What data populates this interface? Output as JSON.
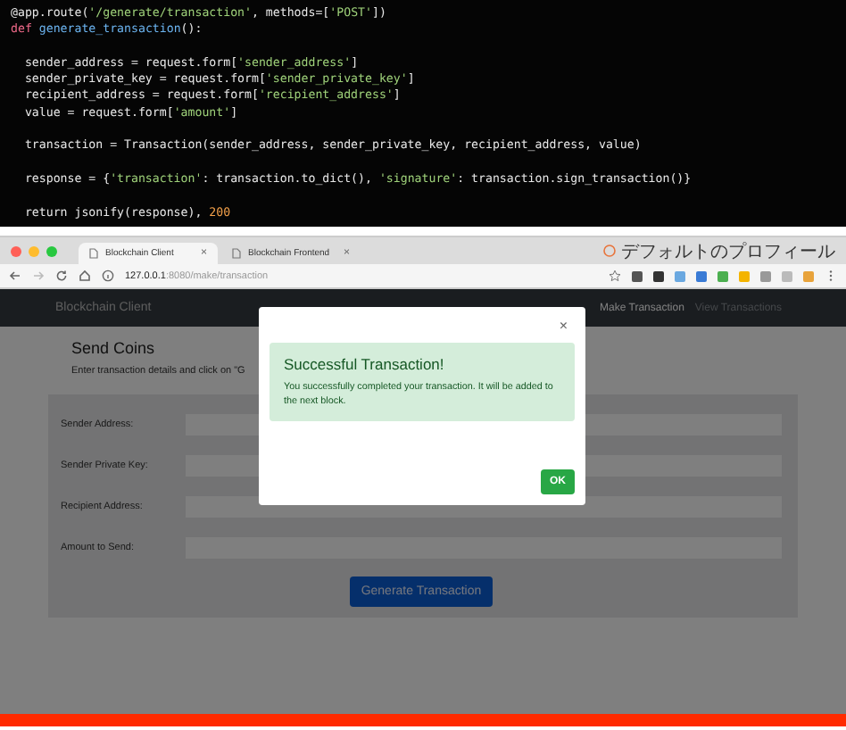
{
  "code": {
    "lines": [
      {
        "blank_before": false,
        "tokens": [
          {
            "text": "@app.route(",
            "kind": "plain"
          },
          {
            "text": "'/generate/transaction'",
            "kind": "string"
          },
          {
            "text": ", methods=[",
            "kind": "plain"
          },
          {
            "text": "'POST'",
            "kind": "string"
          },
          {
            "text": "])",
            "kind": "plain"
          }
        ]
      },
      {
        "blank_before": false,
        "tokens": [
          {
            "text": "def",
            "kind": "keyword"
          },
          {
            "text": " generate_transaction",
            "kind": "function"
          },
          {
            "text": "():",
            "kind": "plain"
          }
        ]
      },
      {
        "blank_before": true,
        "tokens": [
          {
            "text": "  sender_address = request.form[",
            "kind": "plain"
          },
          {
            "text": "'sender_address'",
            "kind": "string"
          },
          {
            "text": "]",
            "kind": "plain"
          }
        ]
      },
      {
        "blank_before": false,
        "tokens": [
          {
            "text": "  sender_private_key = request.form[",
            "kind": "plain"
          },
          {
            "text": "'sender_private_key'",
            "kind": "string"
          },
          {
            "text": "]",
            "kind": "plain"
          }
        ]
      },
      {
        "blank_before": false,
        "tokens": [
          {
            "text": "  recipient_address = request.form[",
            "kind": "plain"
          },
          {
            "text": "'recipient_address'",
            "kind": "string"
          },
          {
            "text": "]",
            "kind": "plain"
          }
        ]
      },
      {
        "blank_before": false,
        "tokens": [
          {
            "text": "  value = request.form[",
            "kind": "plain"
          },
          {
            "text": "'amount'",
            "kind": "string"
          },
          {
            "text": "]",
            "kind": "plain"
          }
        ]
      },
      {
        "blank_before": true,
        "tokens": [
          {
            "text": "  transaction = Transaction(sender_address, sender_private_key, recipient_address, value)",
            "kind": "plain"
          }
        ]
      },
      {
        "blank_before": true,
        "tokens": [
          {
            "text": "  response = {",
            "kind": "plain"
          },
          {
            "text": "'transaction'",
            "kind": "string"
          },
          {
            "text": ": transaction.to_dict(), ",
            "kind": "plain"
          },
          {
            "text": "'signature'",
            "kind": "string"
          },
          {
            "text": ": transaction.sign_transaction()}",
            "kind": "plain"
          }
        ]
      },
      {
        "blank_before": true,
        "tokens": [
          {
            "text": "  return jsonify(response), ",
            "kind": "plain"
          },
          {
            "text": "200",
            "kind": "number"
          }
        ]
      }
    ]
  },
  "browser": {
    "tabs": [
      {
        "label": "Blockchain Client",
        "selected": true,
        "close": "×"
      },
      {
        "label": "Blockchain Frontend",
        "selected": false,
        "close": "×"
      }
    ],
    "profile": "デフォルトのプロフィール",
    "address": "**127.0.0.1**:8080/make/transaction"
  },
  "navbar": {
    "brand": "Blockchain Client",
    "items": [
      {
        "label": "Make Transaction",
        "selected": true
      },
      {
        "label": "View Transactions",
        "selected": false
      }
    ]
  },
  "page": {
    "title": "Send Coins",
    "description": "Enter transaction details and click on \"G",
    "fields": [
      {
        "label": "Sender Address:"
      },
      {
        "label": "Sender Private Key:"
      },
      {
        "label": "Recipient Address:"
      },
      {
        "label": "Amount to Send:"
      }
    ],
    "button": "Generate Transaction"
  },
  "modal": {
    "close": "×",
    "alert_title": "Successful Transaction!",
    "alert_text": "You successfully completed your transaction. It will be added to the next block.",
    "ok": "OK"
  }
}
